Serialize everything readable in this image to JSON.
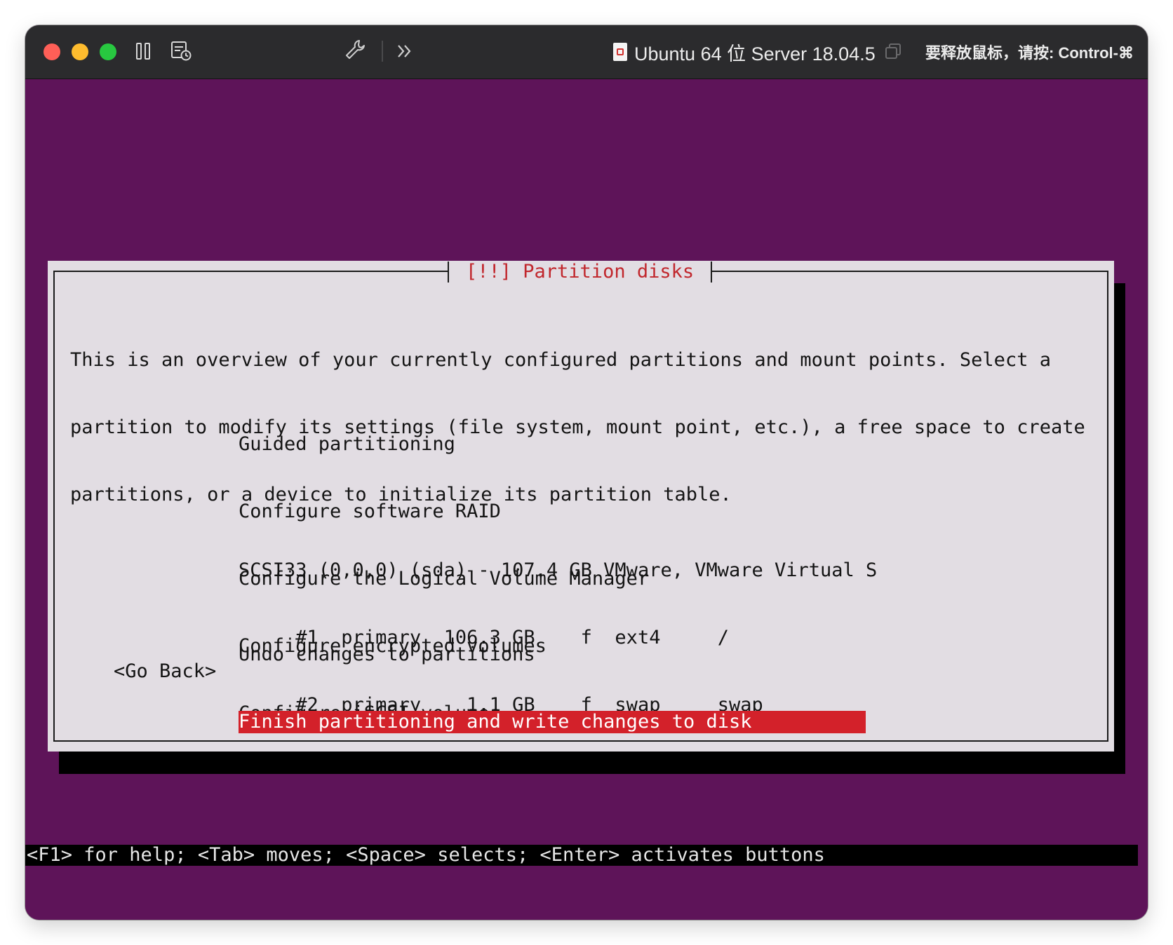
{
  "window": {
    "title": "Ubuntu 64 位 Server 18.04.5",
    "release_hint": "要释放鼠标，请按: Control-⌘"
  },
  "colors": {
    "console_bg": "#5e1459",
    "dialog_bg": "#e2dde3",
    "title_text": "#c1272d",
    "highlight": "#d3212a"
  },
  "icons": [
    "pause-icon",
    "snapshot-icon",
    "wrench-icon",
    "chevrons-right-icon",
    "document-icon",
    "window-copy-icon"
  ],
  "dialog": {
    "title": "[!!] Partition disks",
    "intro": [
      "This is an overview of your currently configured partitions and mount points. Select a",
      "partition to modify its settings (file system, mount point, etc.), a free space to create",
      "partitions, or a device to initialize its partition table."
    ],
    "actions": [
      "Guided partitioning",
      "Configure software RAID",
      "Configure the Logical Volume Manager",
      "Configure encrypted volumes",
      "Configure iSCSI volumes"
    ],
    "disk": "SCSI33 (0,0,0) (sda) - 107.4 GB VMware, VMware Virtual S",
    "partitions": [
      "     #1  primary  106.3 GB    f  ext4     /",
      "     #2  primary    1.1 GB    f  swap     swap"
    ],
    "undo": "Undo changes to partitions",
    "finish": "Finish partitioning and write changes to disk",
    "go_back": "<Go Back>"
  },
  "footer": "<F1> for help; <Tab> moves; <Space> selects; <Enter> activates buttons"
}
